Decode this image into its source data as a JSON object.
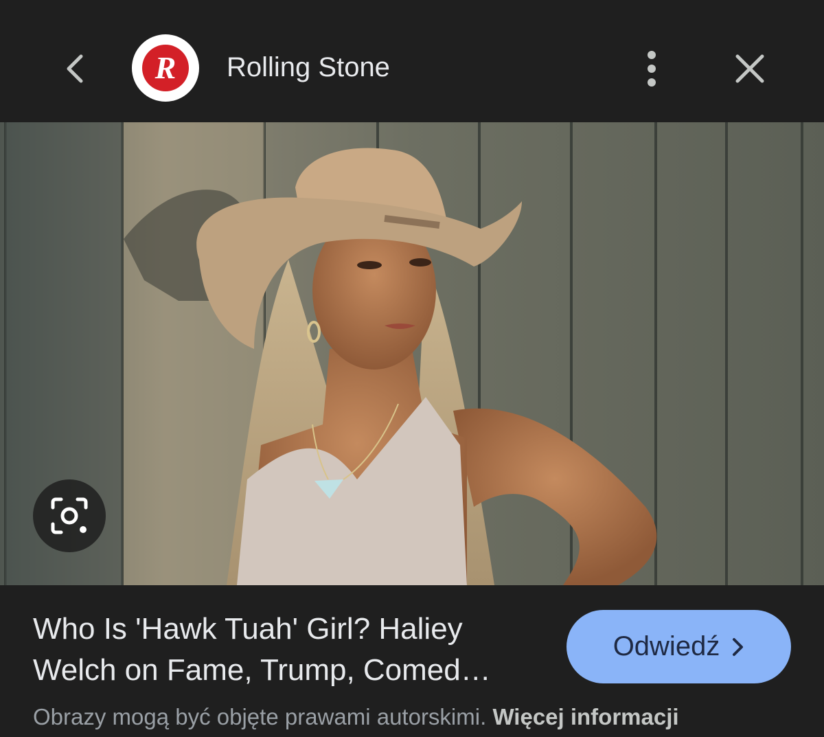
{
  "header": {
    "back_icon": "chevron-left-icon",
    "logo_letter": "R",
    "logo_color": "#d32027",
    "site_name": "Rolling Stone",
    "menu_icon": "more-vert-icon",
    "close_icon": "close-icon"
  },
  "image": {
    "description_icon": "lens-search-icon"
  },
  "result": {
    "title_line1": "Who Is 'Hawk Tuah' Girl? Haliey",
    "title_line2": "Welch on Fame, Trump, Comed…",
    "visit_label": "Odwiedź",
    "visit_icon": "chevron-right-icon",
    "accent_color": "#8ab4f8"
  },
  "footer": {
    "copyright_text": "Obrazy mogą być objęte prawami autorskimi.",
    "more_info_label": "Więcej informacji"
  }
}
